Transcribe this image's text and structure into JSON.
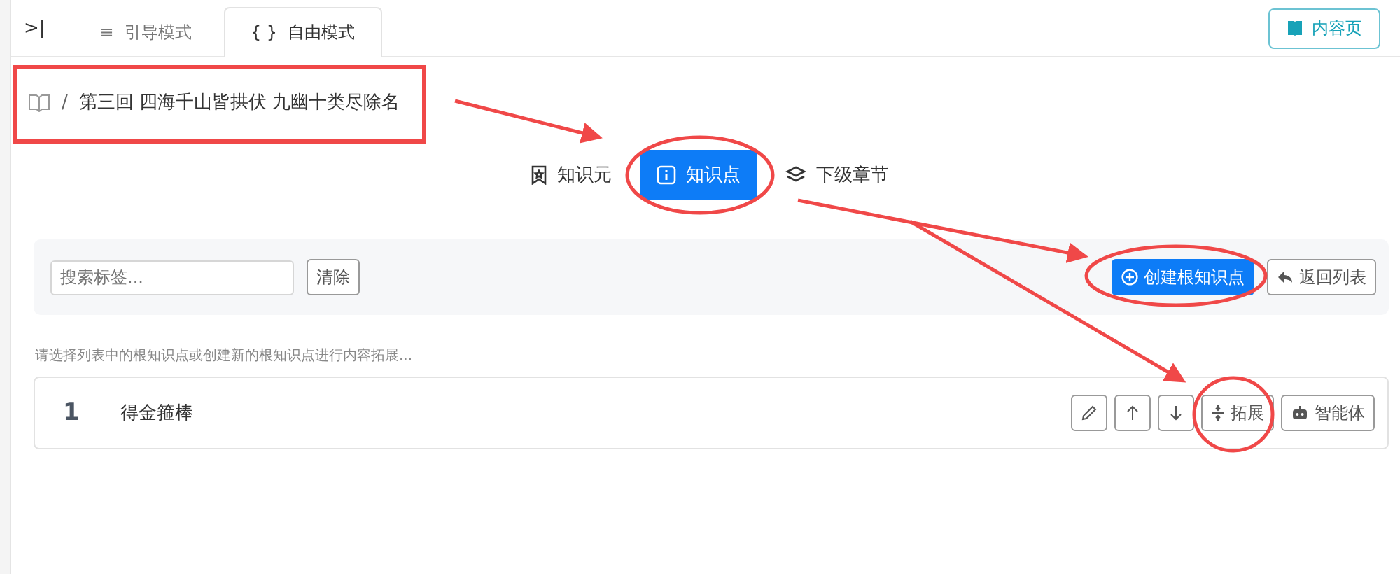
{
  "collapse_toggle": ">|",
  "mode_tabs": [
    {
      "icon": "≡",
      "label": "引导模式",
      "selected": false
    },
    {
      "icon": "{ }",
      "label": "自由模式",
      "selected": true
    }
  ],
  "content_page_button": "内容页",
  "breadcrumb": {
    "separator": "/",
    "title": "第三回 四海千山皆拱伏 九幽十类尽除名"
  },
  "view_tabs": [
    {
      "kind": "bookmark",
      "label": "知识元",
      "selected": false
    },
    {
      "kind": "info",
      "label": "知识点",
      "selected": true
    },
    {
      "kind": "layers",
      "label": "下级章节",
      "selected": false
    }
  ],
  "toolbar": {
    "search": {
      "placeholder": "搜索标签..."
    },
    "clear_button": "清除",
    "create_button": "创建根知识点",
    "back_button": "返回列表"
  },
  "hint": "请选择列表中的根知识点或创建新的根知识点进行内容拓展...",
  "rows": [
    {
      "index": "1",
      "title": "得金箍棒",
      "expand_button": "拓展",
      "agent_button": "智能体"
    }
  ]
}
